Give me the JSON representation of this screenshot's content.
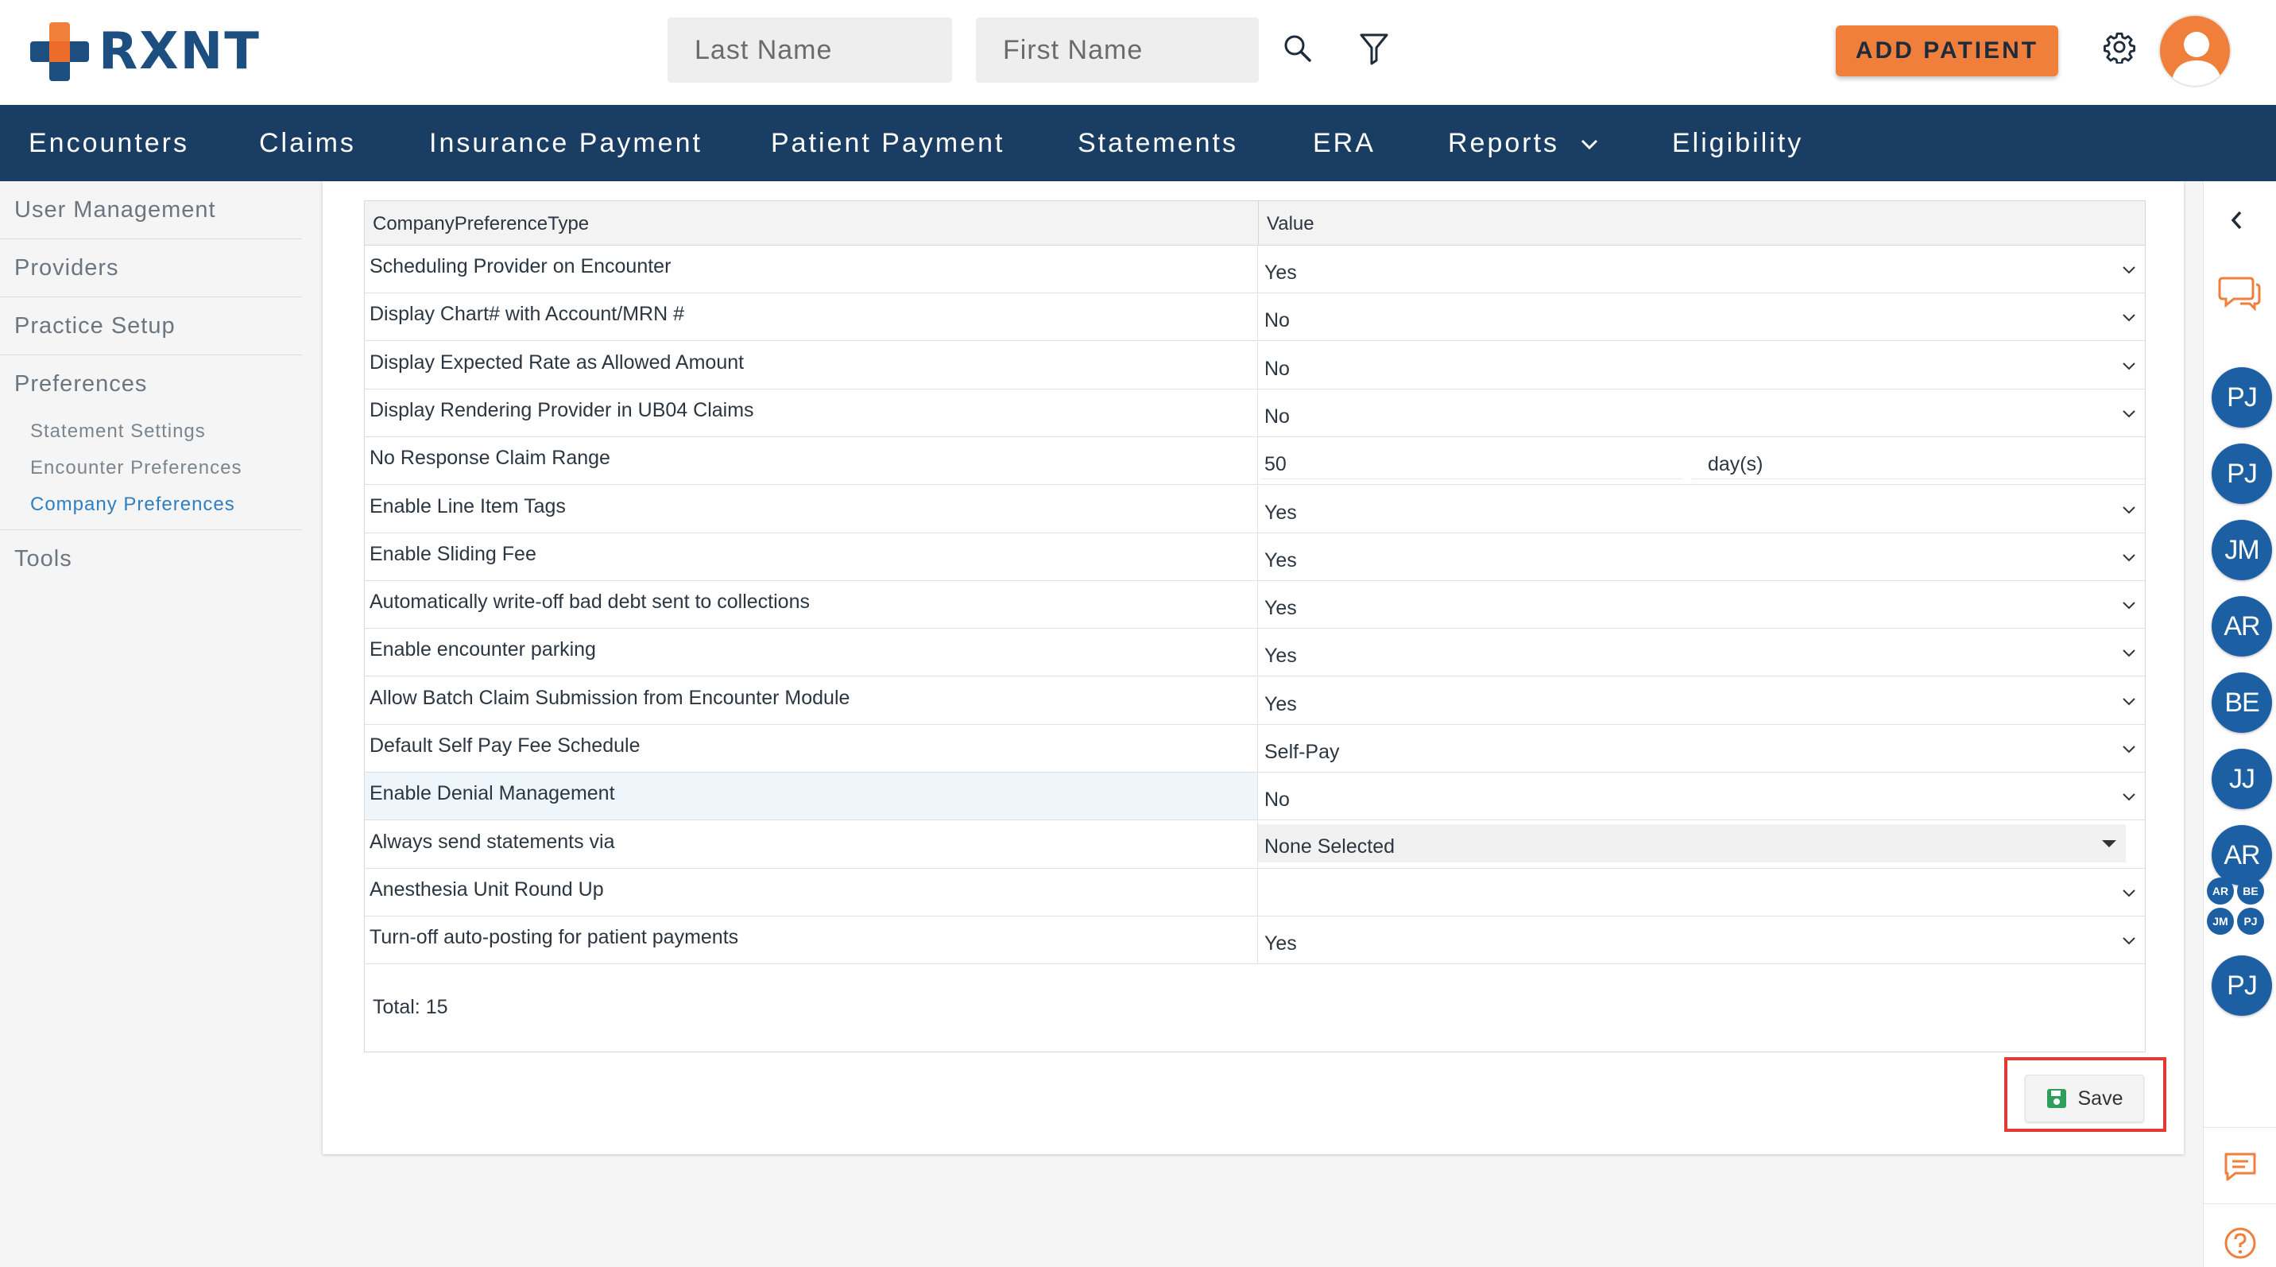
{
  "app": {
    "logo_text": "RXNT"
  },
  "header": {
    "last_name_placeholder": "Last Name",
    "first_name_placeholder": "First Name",
    "add_patient_label": "ADD PATIENT"
  },
  "nav": {
    "items": [
      {
        "label": "Encounters"
      },
      {
        "label": "Claims"
      },
      {
        "label": "Insurance Payment"
      },
      {
        "label": "Patient Payment"
      },
      {
        "label": "Statements"
      },
      {
        "label": "ERA"
      },
      {
        "label": "Reports"
      },
      {
        "label": "Eligibility"
      }
    ]
  },
  "sidebar": {
    "items": [
      {
        "label": "User Management"
      },
      {
        "label": "Providers"
      },
      {
        "label": "Practice Setup"
      },
      {
        "label": "Preferences"
      },
      {
        "label": "Tools"
      }
    ],
    "sub_items": [
      {
        "label": "Statement Settings"
      },
      {
        "label": "Encounter Preferences"
      },
      {
        "label": "Company Preferences",
        "active": true
      }
    ]
  },
  "grid": {
    "columns": [
      "CompanyPreferenceType",
      "Value"
    ],
    "rows": [
      {
        "type": "Scheduling Provider on Encounter",
        "value": "Yes"
      },
      {
        "type": "Display Chart# with Account/MRN #",
        "value": "No"
      },
      {
        "type": "Display Expected Rate as Allowed Amount",
        "value": "No"
      },
      {
        "type": "Display Rendering Provider in UB04 Claims",
        "value": "No"
      },
      {
        "type": "No Response Claim Range",
        "value": "50",
        "unit": "day(s)"
      },
      {
        "type": "Enable Line Item Tags",
        "value": "Yes"
      },
      {
        "type": "Enable Sliding Fee",
        "value": "Yes"
      },
      {
        "type": "Automatically write-off bad debt sent to collections",
        "value": "Yes"
      },
      {
        "type": "Enable encounter parking",
        "value": "Yes"
      },
      {
        "type": "Allow Batch Claim Submission from Encounter Module",
        "value": "Yes"
      },
      {
        "type": "Default Self Pay Fee Schedule",
        "value": "Self-Pay"
      },
      {
        "type": "Enable Denial Management",
        "value": "No"
      },
      {
        "type": "Always send statements via",
        "value": "None Selected"
      },
      {
        "type": "Anesthesia Unit Round Up",
        "value": ""
      },
      {
        "type": "Turn-off auto-posting for patient payments",
        "value": "Yes"
      }
    ],
    "total": "Total: 15"
  },
  "save_label": "Save",
  "rail": {
    "avatars": [
      "PJ",
      "PJ",
      "JM",
      "AR",
      "BE",
      "JJ",
      "AR"
    ],
    "mini_avatars": [
      "AR",
      "BE",
      "JM",
      "PJ"
    ],
    "last_avatar": "PJ"
  },
  "colors": {
    "navbar": "#1a3e63",
    "accent_orange": "#f07f3c",
    "brand_blue": "#1c4e80",
    "avatar_blue": "#1d5fa3",
    "highlight_red": "#e53935"
  }
}
